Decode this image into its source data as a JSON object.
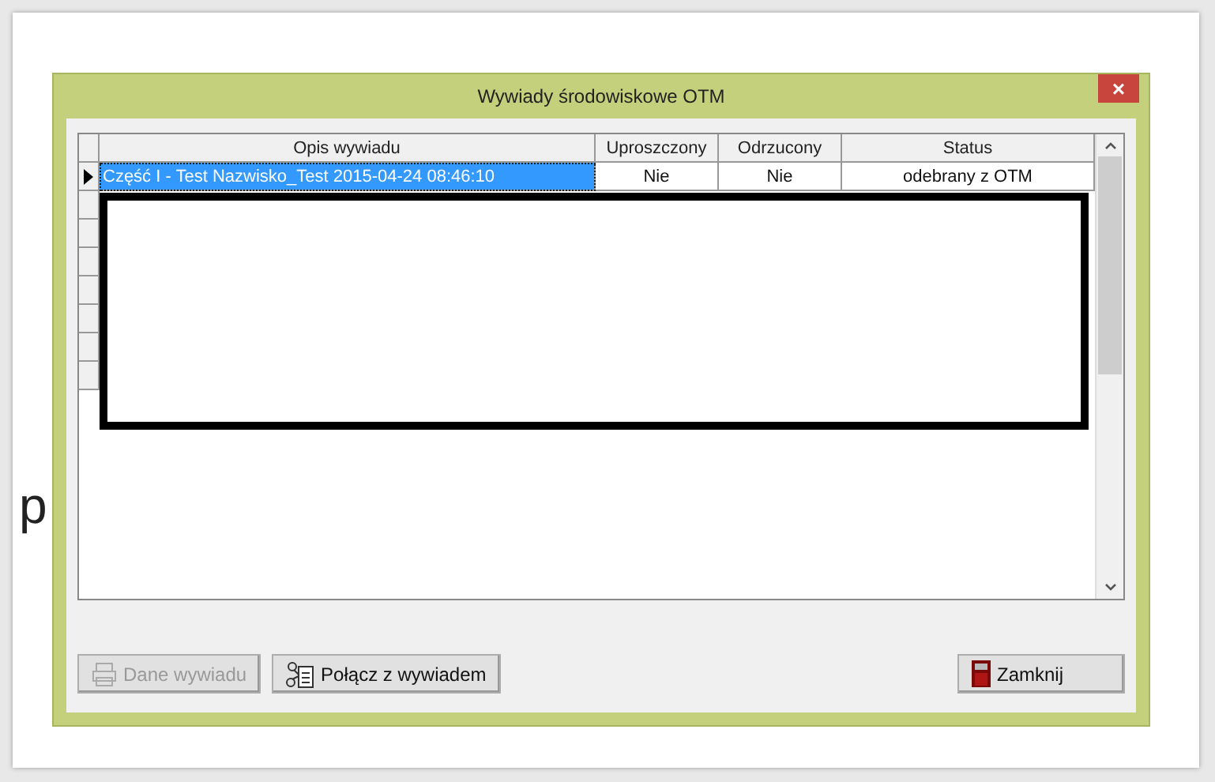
{
  "background_fragments": [
    {
      "text": "p",
      "kind": "body"
    }
  ],
  "window": {
    "title": "Wywiady środowiskowe OTM",
    "close": "×"
  },
  "table": {
    "columns": [
      "Opis wywiadu",
      "Uproszczony",
      "Odrzucony",
      "Status"
    ],
    "rows": [
      {
        "cells": [
          "Część I - Test Nazwisko_Test 2015-04-24 08:46:10",
          "Nie",
          "Nie",
          "odebrany z OTM"
        ],
        "selected": true
      }
    ]
  },
  "buttons": [
    {
      "label": "Dane wywiadu",
      "disabled": true
    },
    {
      "label": "Połącz z wywiadem",
      "disabled": false
    },
    {
      "label": "Zamknij",
      "disabled": false
    }
  ]
}
